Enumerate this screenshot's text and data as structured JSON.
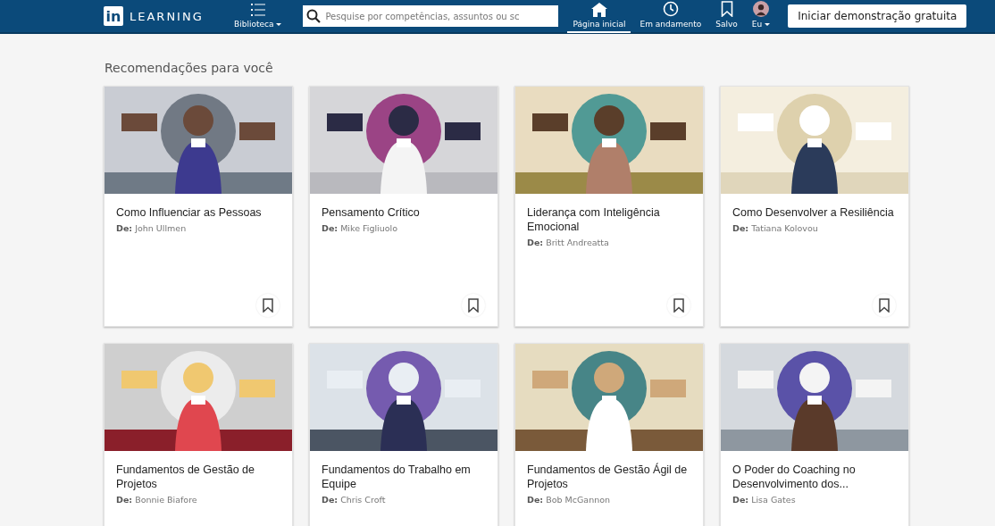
{
  "header": {
    "logo_badge": "in",
    "logo_text": "LEARNING",
    "nav": [
      {
        "label": "Biblioteca",
        "dropdown": true,
        "selected": false
      },
      {
        "label": "Página inicial",
        "dropdown": false,
        "selected": true
      },
      {
        "label": "Em andamento",
        "dropdown": false,
        "selected": false
      },
      {
        "label": "Salvo",
        "dropdown": false,
        "selected": false
      },
      {
        "label": "Eu",
        "dropdown": true,
        "selected": false
      }
    ],
    "search": {
      "placeholder": "Pesquise por competências, assuntos ou sc"
    },
    "cta": "Iniciar demonstração gratuita"
  },
  "section_title": "Recomendações para você",
  "courses": [
    {
      "title": "Como Influenciar as Pessoas",
      "author": "**De:** John Ullmen",
      "bookmark": true
    },
    {
      "title": "Pensamento Crítico",
      "author": "**De:** Mike Figliuolo",
      "bookmark": true
    },
    {
      "title": "Liderança com Inteligência Emocional",
      "author": "**De:** Britt Andreatta",
      "bookmark": true
    },
    {
      "title": "Como Desenvolver a Resiliência",
      "author": "**De:** Tatiana Kolovou",
      "bookmark": true
    },
    {
      "title": "Fundamentos de Gestão de Projetos",
      "author": "**De:** Bonnie Biafore"
    },
    {
      "title": "Fundamentos do Trabalho em Equipe",
      "author": "**De:** Chris Croft"
    },
    {
      "title": "Fundamentos de Gestão Ágil de Projetos",
      "author": "**De:** Bob McGannon"
    },
    {
      "title": "O Poder do Coaching no Desenvolvimento dos...",
      "author": "**De:** Lisa Gates"
    }
  ]
}
